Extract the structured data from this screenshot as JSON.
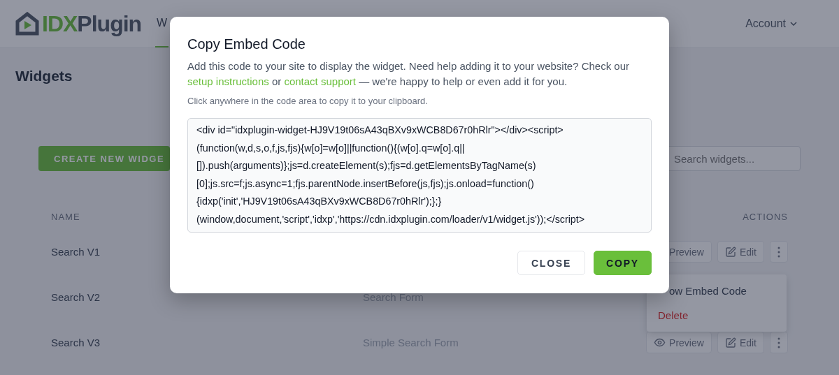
{
  "header": {
    "logo": {
      "part_1": "IDX",
      "part_2": "Plugin"
    },
    "nav": [
      {
        "label": "W",
        "selected": true
      }
    ],
    "account": "Account"
  },
  "page_title": "Widgets",
  "toolbar": {
    "create_button": "CREATE NEW WIDGE",
    "search": {
      "placeholder": "Search widgets..."
    }
  },
  "table": {
    "columns": [
      "NAME",
      "ACTIONS"
    ],
    "rows": [
      {
        "name": "Search V1",
        "actions": [
          "Preview",
          "Edit"
        ]
      },
      {
        "name": "Search V2",
        "type": "Search Form"
      },
      {
        "name": "Search V3",
        "type": "Simple Search Form",
        "actions": [
          "Preview",
          "Edit"
        ],
        "preview_icon": true
      }
    ]
  },
  "row_menu": {
    "items": [
      {
        "label": "ow Embed Code",
        "kind": "normal"
      },
      {
        "label": "Delete",
        "kind": "danger"
      }
    ]
  },
  "modal": {
    "title": "Copy Embed Code",
    "description": "Add this code to your site to display the widget. Need help adding it to your website? Check our ",
    "link_1": "setup instructions",
    "middle": " or ",
    "link_2": "contact support",
    "description_end": " — we're happy to help or even add it for you.",
    "hint": "Click anywhere in the code area to copy it to your clipboard.",
    "code_lines": [
      "<div id=\"idxplugin-widget-HJ9V19t06sA43qBXv9xWCB8D67r0hRlr\"></div><script>",
      "(function(w,d,s,o,f,js,fjs){w[o]=w[o]||function(){(w[o].q=w[o].q||",
      "[]).push(arguments)};js=d.createElement(s);fjs=d.getElementsByTagName(s)",
      "[0];js.src=f;js.async=1;fjs.parentNode.insertBefore(js,fjs);js.onload=function()",
      "{idxp('init','HJ9V19t06sA43qBXv9xWCB8D67r0hRlr');};}",
      "(window,document,'script','idxp','https://cdn.idxplugin.com/loader/v1/widget.js'));</script>"
    ],
    "buttons": [
      {
        "label": "CLOSE",
        "kind": "secondary"
      },
      {
        "label": "COPY",
        "kind": "primary"
      }
    ]
  }
}
